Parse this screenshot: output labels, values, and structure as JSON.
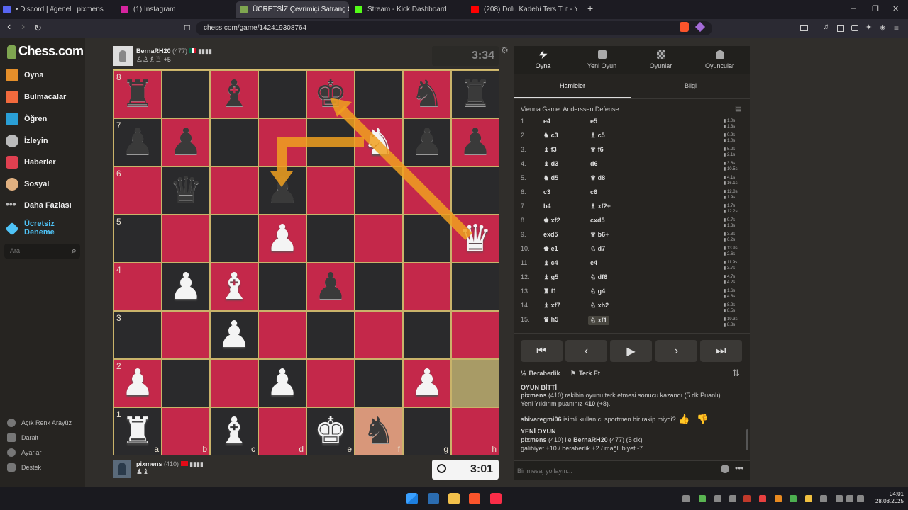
{
  "browser": {
    "tabs": [
      {
        "label": "• Discord | #genel | pixmens",
        "color": "#5865f2"
      },
      {
        "label": "(1) Instagram",
        "color": "#d6249f"
      },
      {
        "label": "ÜCRETSİZ Çevrimiçi Satranç Oyna",
        "color": "#7fa650",
        "close": "✕"
      },
      {
        "label": "Stream - Kick Dashboard",
        "color": "#53fc18"
      },
      {
        "label": "(208) Dolu Kadehi Ters Tut - Yapı",
        "color": "#ff0000"
      }
    ],
    "new_tab": "+",
    "window_controls": {
      "minimize": "–",
      "restore": "❐",
      "close": "✕"
    },
    "url": "chess.com/game/142419308764",
    "back": "‹",
    "forward": "›",
    "reload": "↻"
  },
  "sidebar": {
    "logo": "Chess.com",
    "items": [
      {
        "label": "Oyna",
        "color": "#e58f2a"
      },
      {
        "label": "Bulmacalar",
        "color": "#f26a3d"
      },
      {
        "label": "Öğren",
        "color": "#2a9fd6"
      },
      {
        "label": "İzleyin",
        "color": "#bbbbbb"
      },
      {
        "label": "Haberler",
        "color": "#e04050"
      },
      {
        "label": "Sosyal",
        "color": "#e0b080"
      },
      {
        "label": "Daha Fazlası",
        "color": "#bbbbbb"
      }
    ],
    "trial": "Ücretsiz Deneme",
    "search_placeholder": "Ara",
    "bottom": [
      "Açık Renk Arayüz",
      "Daralt",
      "Ayarlar",
      "Destek"
    ]
  },
  "game": {
    "top_player": {
      "name": "BernaRH20",
      "rating": "(477)",
      "extra": "+5",
      "clock": "3:34"
    },
    "bottom_player": {
      "name": "pixmens",
      "rating": "(410)",
      "clock": "3:01"
    },
    "files": [
      "a",
      "b",
      "c",
      "d",
      "e",
      "f",
      "g",
      "h"
    ],
    "ranks": [
      "8",
      "7",
      "6",
      "5",
      "4",
      "3",
      "2",
      "1"
    ],
    "position": [
      [
        "r",
        "",
        "b",
        "",
        "k",
        "",
        "n",
        "r"
      ],
      [
        "p",
        "p",
        "",
        "",
        "",
        "N",
        "p",
        "p"
      ],
      [
        "",
        "q",
        "",
        "p",
        "",
        "",
        "",
        ""
      ],
      [
        "",
        "",
        "",
        "P",
        "",
        "",
        "",
        "Q"
      ],
      [
        "",
        "P",
        "B",
        "",
        "p",
        "",
        "",
        ""
      ],
      [
        "",
        "",
        "P",
        "",
        "",
        "",
        "",
        ""
      ],
      [
        "P",
        "",
        "",
        "P",
        "",
        "",
        "P",
        ""
      ],
      [
        "R",
        "",
        "B",
        "",
        "K",
        "n",
        "",
        ""
      ]
    ],
    "highlight_from": "h2",
    "highlight_to": "f1"
  },
  "panel": {
    "tabs": [
      "Oyna",
      "Yeni Oyun",
      "Oyunlar",
      "Oyuncular"
    ],
    "subtabs": [
      "Hamleler",
      "Bilgi"
    ],
    "opening": "Vienna Game: Anderssen Defense",
    "moves": [
      {
        "n": "1.",
        "w": "e4",
        "b": "e5",
        "tw": "1.0s",
        "tb": "1.3s"
      },
      {
        "n": "2.",
        "w": "♞ c3",
        "b": "♗ c5",
        "tw": "0.9s",
        "tb": "1.0s"
      },
      {
        "n": "3.",
        "w": "♝ f3",
        "b": "♕ f6",
        "tw": "5.2s",
        "tb": "2.1s"
      },
      {
        "n": "4.",
        "w": "♝ d3",
        "b": "d6",
        "tw": "3.6s",
        "tb": "10.5s"
      },
      {
        "n": "5.",
        "w": "♞ d5",
        "b": "♕ d8",
        "tw": "4.1s",
        "tb": "16.1s"
      },
      {
        "n": "6.",
        "w": "c3",
        "b": "c6",
        "tw": "12.8s",
        "tb": "1.9s"
      },
      {
        "n": "7.",
        "w": "b4",
        "b": "♗ xf2+",
        "tw": "1.7s",
        "tb": "12.2s"
      },
      {
        "n": "8.",
        "w": "♚ xf2",
        "b": "cxd5",
        "tw": "9.7s",
        "tb": "1.3s"
      },
      {
        "n": "9.",
        "w": "exd5",
        "b": "♕ b6+",
        "tw": "3.3s",
        "tb": "6.2s"
      },
      {
        "n": "10.",
        "w": "♚ e1",
        "b": "♘ d7",
        "tw": "13.9s",
        "tb": "2.6s"
      },
      {
        "n": "11.",
        "w": "♝ c4",
        "b": "e4",
        "tw": "11.9s",
        "tb": "3.7s"
      },
      {
        "n": "12.",
        "w": "♝ g5",
        "b": "♘ df6",
        "tw": "4.7s",
        "tb": "4.2s"
      },
      {
        "n": "13.",
        "w": "♜ f1",
        "b": "♘ g4",
        "tw": "1.6s",
        "tb": "4.8s"
      },
      {
        "n": "14.",
        "w": "♝ xf7",
        "b": "♘ xh2",
        "tw": "8.2s",
        "tb": "8.5s"
      },
      {
        "n": "15.",
        "w": "♛ h5",
        "b": "♘ xf1",
        "tw": "19.3s",
        "tb": "8.8s"
      }
    ],
    "nav": [
      "⏮",
      "‹",
      "▶",
      "›",
      "⏭"
    ],
    "draw": "Beraberlik",
    "resign": "Terk Et",
    "chat": {
      "game_over": "OYUN BİTTİ",
      "result_name": "pixmens",
      "result_text": "(410) rakibin oyunu terk etmesi sonucu kazandı (5 dk Puanlı)",
      "new_rating_pre": "Yeni Yıldırım puanınız",
      "new_rating_val": "410",
      "new_rating_delta": "(+8).",
      "sportsman": "shivaregmi06",
      "sportsman_text": "isimli kullanıcı sportmen bir rakip miydi?",
      "new_game": "YENİ OYUN",
      "ng_p1": "pixmens",
      "ng_mid": "(410) ile",
      "ng_p2": "BernaRH20",
      "ng_tail": "(477) (5 dk)",
      "score_line": "galibiyet +10 / beraberlik +2 / mağlubiyet -7",
      "input_placeholder": "Bir mesaj yollayın..."
    }
  },
  "taskbar": {
    "time": "04:01",
    "date": "28.08.2025"
  }
}
